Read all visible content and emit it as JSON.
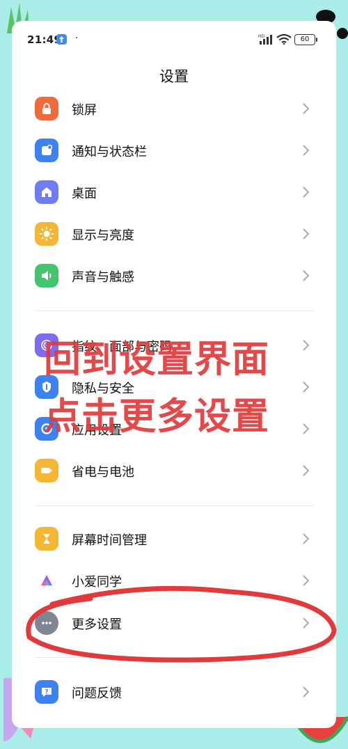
{
  "status_bar": {
    "time": "21:49",
    "dot": "·",
    "battery": "60"
  },
  "header": {
    "title": "设置"
  },
  "settings": {
    "group1": [
      {
        "label": "锁屏",
        "icon": "lock-icon",
        "color": "#f06a3c"
      },
      {
        "label": "通知与状态栏",
        "icon": "notification-icon",
        "color": "#3d82f0"
      },
      {
        "label": "桌面",
        "icon": "home-icon",
        "color": "#6f7cf2"
      },
      {
        "label": "显示与亮度",
        "icon": "sun-icon",
        "color": "#f4b633"
      },
      {
        "label": "声音与触感",
        "icon": "speaker-icon",
        "color": "#44c46c"
      }
    ],
    "group2": [
      {
        "label": "指纹、面部与密码",
        "icon": "fingerprint-icon",
        "color": "#7c6cf0"
      },
      {
        "label": "隐私与安全",
        "icon": "privacy-icon",
        "color": "#3d82f0"
      },
      {
        "label": "应用设置",
        "icon": "app-settings-icon",
        "color": "#3d82f0"
      },
      {
        "label": "省电与电池",
        "icon": "battery-icon",
        "color": "#f4b633"
      }
    ],
    "group3": [
      {
        "label": "屏幕时间管理",
        "icon": "hourglass-icon",
        "color": "#f4b633"
      },
      {
        "label": "小爱同学",
        "icon": "xiaoai-icon",
        "color": "#ffffff"
      },
      {
        "label": "更多设置",
        "icon": "more-icon",
        "color": "#7e8696"
      }
    ],
    "group4": [
      {
        "label": "问题反馈",
        "icon": "feedback-icon",
        "color": "#3d82f0"
      }
    ]
  },
  "overlay": {
    "line1": "回到设置界面",
    "line2": "点击更多设置",
    "color": "#e23a3a"
  }
}
